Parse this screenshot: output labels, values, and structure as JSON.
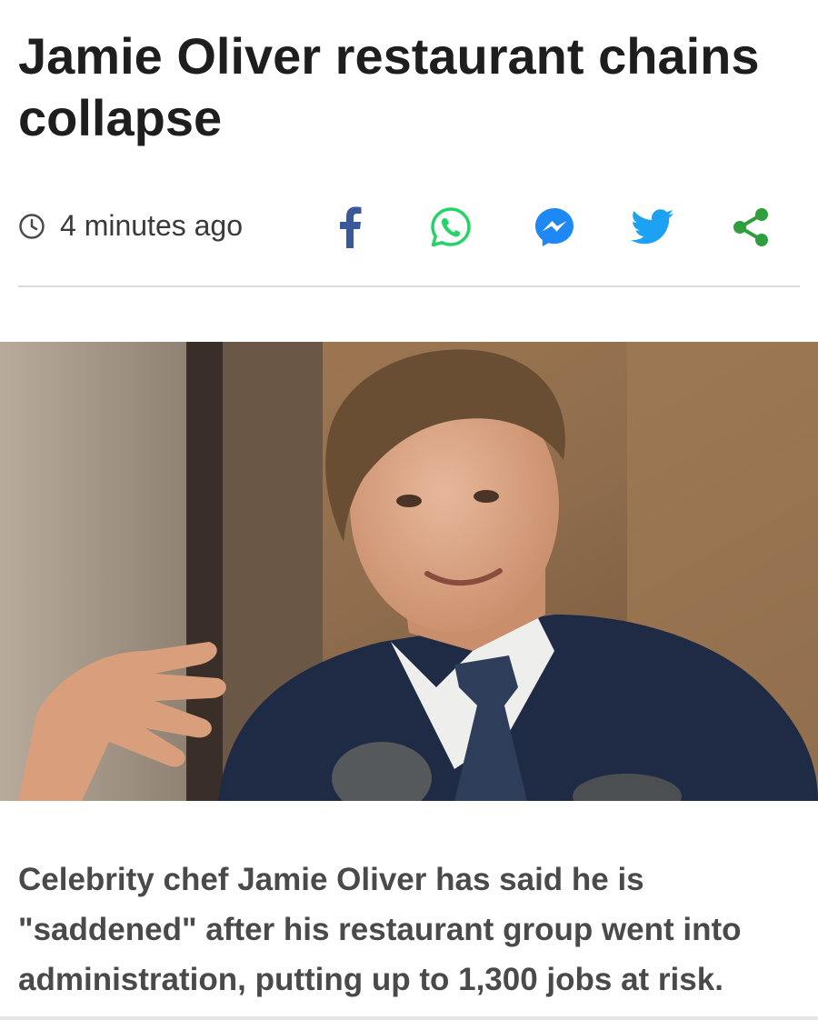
{
  "article": {
    "headline": "Jamie Oliver restaurant chains collapse",
    "timestamp": "4 minutes ago",
    "lede": "Celebrity chef Jamie Oliver has said he is \"saddened\" after his restaurant group went into administration, putting up to 1,300 jobs at risk."
  },
  "share": {
    "icons": [
      "facebook-icon",
      "whatsapp-icon",
      "messenger-icon",
      "twitter-icon",
      "share-icon"
    ]
  },
  "colors": {
    "facebook": "#3b5998",
    "whatsapp": "#25d366",
    "messenger": "#1e88f5",
    "twitter": "#1da1f2",
    "share": "#2e9e3e",
    "headline": "#1e1e1e",
    "lede": "#4a4a4a"
  }
}
